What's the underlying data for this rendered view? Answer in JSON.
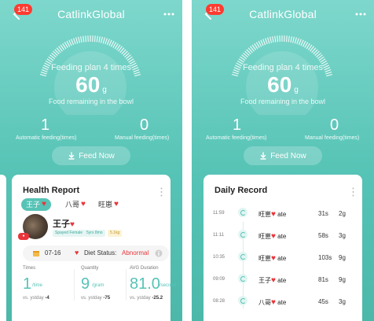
{
  "screens": [
    {
      "id": "left",
      "header": {
        "badge": "141",
        "title": "CatlinkGlobal"
      },
      "gauge": {
        "plan": "Feeding plan 4 times",
        "value": "60",
        "unit": "g",
        "remain": "Food remaining in the bowl"
      },
      "counts": {
        "automatic": "1",
        "automatic_label": "Automatic feeding(times)",
        "manual": "0",
        "manual_label": "Manual feeding(times)"
      },
      "feed_button": "Feed Now",
      "health": {
        "title": "Health Report",
        "tabs": [
          "王子",
          "八哥",
          "旺崽"
        ],
        "pet": {
          "name": "王子",
          "tags": [
            "Spayed Female",
            "5yrs 8mo",
            "5.1kg"
          ]
        },
        "diet": {
          "date": "07-16",
          "label": "Diet Status:",
          "status": "Abnormal"
        },
        "stats": [
          {
            "title": "Times",
            "value": "1",
            "unit": "/time",
            "vs_label": "vs. ystday",
            "vs_value": "-4"
          },
          {
            "title": "Quantity",
            "value": "9",
            "unit": "/gram",
            "vs_label": "vs. ystday",
            "vs_value": "-75"
          },
          {
            "title": "AVG Duration",
            "value": "81.0",
            "unit": "/second",
            "vs_label": "vs. ystday",
            "vs_value": "-25.2"
          }
        ]
      }
    },
    {
      "id": "right",
      "header": {
        "badge": "141",
        "title": "CatlinkGlobal"
      },
      "gauge": {
        "plan": "Feeding plan 4 times",
        "value": "60",
        "unit": "g",
        "remain": "Food remaining in the bowl"
      },
      "counts": {
        "automatic": "1",
        "automatic_label": "Automatic feeding(times)",
        "manual": "0",
        "manual_label": "Manual feeding(times)"
      },
      "feed_button": "Feed Now",
      "daily": {
        "title": "Daily Record",
        "records": [
          {
            "time": "11:59",
            "name": "旺崽",
            "verb": "ate",
            "duration": "31s",
            "amount": "2g"
          },
          {
            "time": "11:11",
            "name": "旺崽",
            "verb": "ate",
            "duration": "58s",
            "amount": "3g"
          },
          {
            "time": "10:35",
            "name": "旺崽",
            "verb": "ate",
            "duration": "103s",
            "amount": "9g"
          },
          {
            "time": "09:09",
            "name": "王子",
            "verb": "ate",
            "duration": "81s",
            "amount": "9g"
          },
          {
            "time": "08:28",
            "name": "八哥",
            "verb": "ate",
            "duration": "45s",
            "amount": "3g"
          }
        ]
      }
    }
  ],
  "colors": {
    "teal": "#56c3b6",
    "heart": "#e8353a"
  }
}
